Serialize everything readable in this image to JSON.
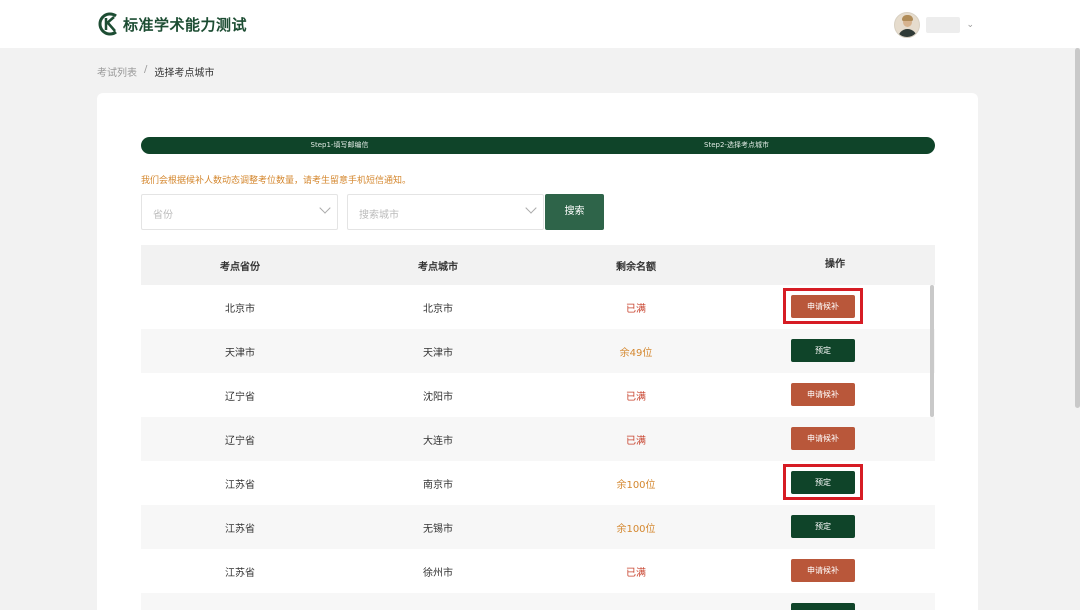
{
  "header": {
    "logo_text": "标准学术能力测试",
    "logo_mark": "k-logo-mark"
  },
  "breadcrumb": {
    "parent": "考试列表",
    "separator": "/",
    "current": "选择考点城市"
  },
  "steps": [
    {
      "label": "Step1-填写邮编信"
    },
    {
      "label": "Step2-选择考点城市"
    }
  ],
  "notice": "我们会根据候补人数动态调整考位数量，请考生留意手机短信通知。",
  "filters": {
    "province_placeholder": "省份",
    "city_placeholder": "搜索城市",
    "search_label": "搜索"
  },
  "table": {
    "headers": [
      "考点省份",
      "考点城市",
      "剩余名额",
      "操作"
    ],
    "rows": [
      {
        "province": "北京市",
        "city": "北京市",
        "remaining": "已满",
        "action": "申请候补"
      },
      {
        "province": "天津市",
        "city": "天津市",
        "remaining": "余49位",
        "action": "预定"
      },
      {
        "province": "辽宁省",
        "city": "沈阳市",
        "remaining": "已满",
        "action": "申请候补"
      },
      {
        "province": "辽宁省",
        "city": "大连市",
        "remaining": "已满",
        "action": "申请候补"
      },
      {
        "province": "江苏省",
        "city": "南京市",
        "remaining": "余100位",
        "action": "预定"
      },
      {
        "province": "江苏省",
        "city": "无锡市",
        "remaining": "余100位",
        "action": "预定"
      },
      {
        "province": "江苏省",
        "city": "徐州市",
        "remaining": "已满",
        "action": "申请候补"
      }
    ]
  },
  "colors": {
    "brand": "#0f4429",
    "waitlist": "#b9573a",
    "full_text": "#c8432e",
    "available_text": "#d4872e",
    "highlight": "#d61c24"
  }
}
